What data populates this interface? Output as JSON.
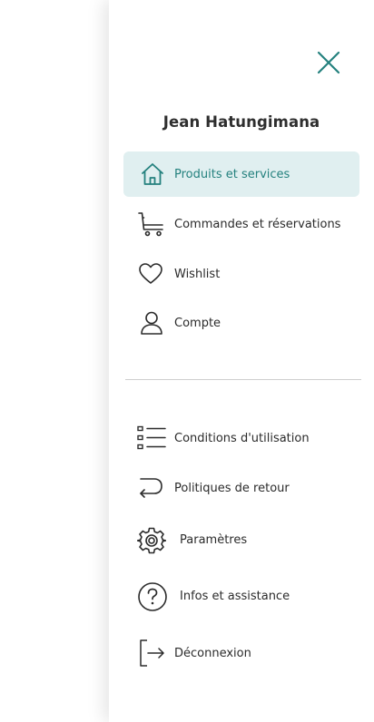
{
  "user": {
    "name": "Jean Hatungimana"
  },
  "colors": {
    "accent": "#24817e",
    "active_bg": "#e0eff0",
    "text": "#2b2b2b"
  },
  "nav_primary": [
    {
      "label": "Produits et services",
      "icon": "home-icon",
      "active": true
    },
    {
      "label": "Commandes et réservations",
      "icon": "cart-icon",
      "active": false
    },
    {
      "label": "Wishlist",
      "icon": "heart-icon",
      "active": false
    },
    {
      "label": "Compte",
      "icon": "user-icon",
      "active": false
    }
  ],
  "nav_secondary": [
    {
      "label": "Conditions d'utilisation",
      "icon": "list-icon"
    },
    {
      "label": "Politiques de retour",
      "icon": "return-arrow-icon"
    },
    {
      "label": "Paramètres",
      "icon": "gear-icon"
    },
    {
      "label": "Infos et assistance",
      "icon": "help-icon"
    },
    {
      "label": "Déconnexion",
      "icon": "logout-icon"
    }
  ]
}
